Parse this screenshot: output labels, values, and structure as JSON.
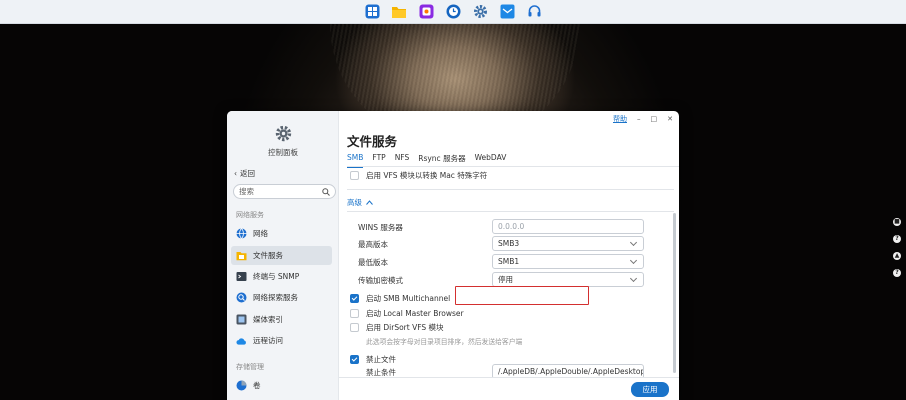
{
  "taskbar": {
    "icons": [
      "app-launcher-icon",
      "file-station-icon",
      "photos-app-icon",
      "clock-app-icon",
      "control-panel-icon",
      "mail-app-icon",
      "support-headset-icon"
    ]
  },
  "right_rail": {
    "icons": [
      "message-icon",
      "question-icon",
      "notification-bell-icon",
      "help-icon"
    ],
    "glyphs": [
      "■",
      "?",
      "▲",
      "?"
    ]
  },
  "window": {
    "app_name": "控制面板",
    "help_link": "帮助",
    "sidebar": {
      "back_label": "返回",
      "search_placeholder": "搜索",
      "groups": [
        {
          "label": "网络服务",
          "items": [
            {
              "label": "网络",
              "icon": "network-globe-icon"
            },
            {
              "label": "文件服务",
              "icon": "file-service-icon",
              "active": true
            },
            {
              "label": "终端与 SNMP",
              "icon": "terminal-icon"
            },
            {
              "label": "网络探索服务",
              "icon": "network-discovery-icon"
            },
            {
              "label": "媒体索引",
              "icon": "media-index-icon"
            },
            {
              "label": "远程访问",
              "icon": "remote-access-cloud-icon"
            }
          ]
        },
        {
          "label": "存储管理",
          "items": [
            {
              "label": "卷",
              "icon": "volume-pie-icon"
            }
          ]
        }
      ]
    },
    "main": {
      "title": "文件服务",
      "tabs": [
        {
          "label": "SMB",
          "active": true
        },
        {
          "label": "FTP"
        },
        {
          "label": "NFS"
        },
        {
          "label": "Rsync 服务器"
        },
        {
          "label": "WebDAV"
        }
      ],
      "top_option": {
        "label": "启用 VFS 模块以转换 Mac 特殊字符",
        "checked": false
      },
      "advanced_label": "高级",
      "fields": [
        {
          "label": "WINS 服务器",
          "value": "",
          "placeholder": "0.0.0.0",
          "type": "text"
        },
        {
          "label": "最高版本",
          "value": "SMB3",
          "type": "select"
        },
        {
          "label": "最低版本",
          "value": "SMB1",
          "type": "select"
        },
        {
          "label": "传输加密模式",
          "value": "停用",
          "type": "select"
        }
      ],
      "options": [
        {
          "label": "启动 SMB Multichannel",
          "checked": true
        },
        {
          "label": "启动 Local Master Browser",
          "checked": false
        },
        {
          "label": "启用 DirSort VFS 模块",
          "checked": false
        }
      ],
      "dirsort_hint": "此选项会按字母对目录项目排序，然后发送给客户端",
      "veto": {
        "label": "禁止文件",
        "checked": true,
        "condition_label": "禁止条件",
        "condition_value": "/.AppleDB/.AppleDouble/.AppleDesktop/Network"
      },
      "apply_label": "应用"
    }
  },
  "colors": {
    "accent": "#1a73c9",
    "highlight_box": "#d32f2f"
  }
}
